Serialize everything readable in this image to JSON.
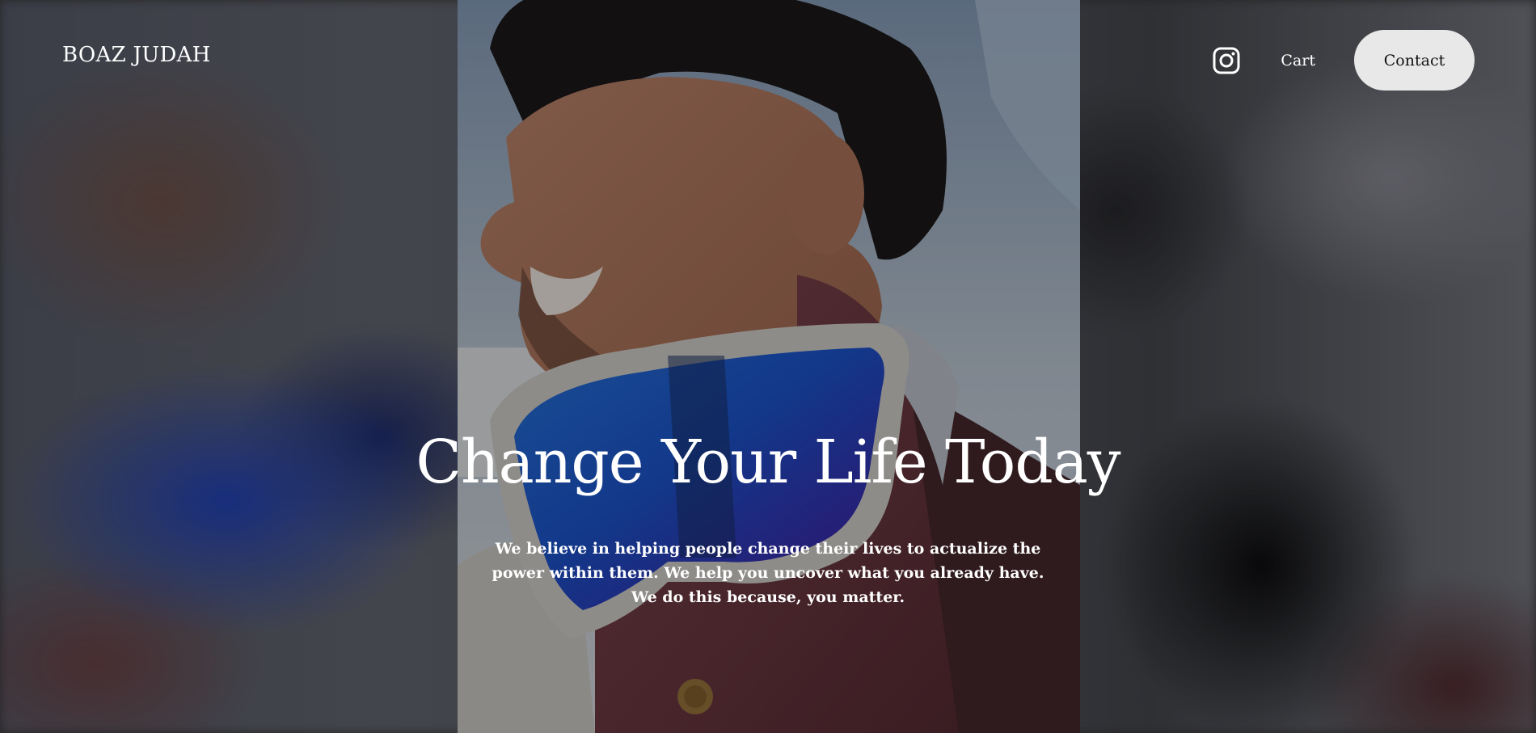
{
  "header": {
    "brand": "BOAZ JUDAH",
    "nav": {
      "instagram_icon": "instagram-icon",
      "cart_label": "Cart",
      "contact_label": "Contact"
    }
  },
  "hero": {
    "title": "Change Your Life Today",
    "subtitle": "We believe in helping people change their lives to actualize the power within them. We help you uncover what you already have. We do this because, you matter."
  },
  "colors": {
    "text": "#ffffff",
    "contact_button_bg": "#e8e8e8",
    "contact_button_text": "#111111"
  }
}
